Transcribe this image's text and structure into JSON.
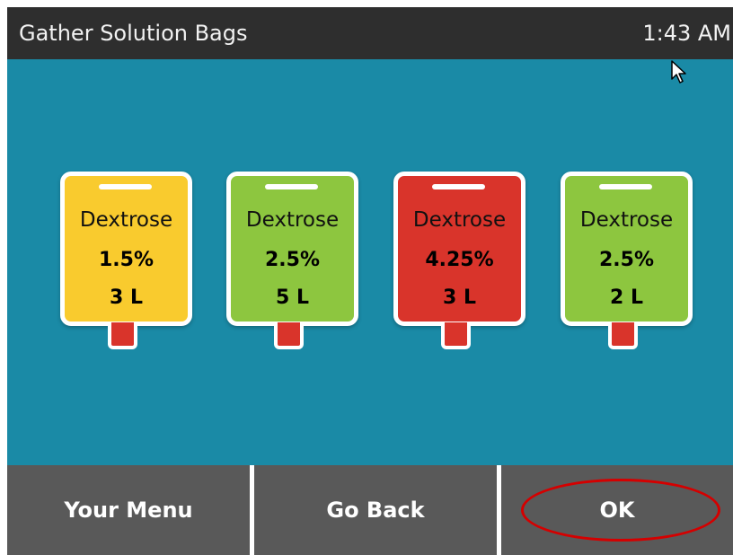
{
  "header": {
    "title": "Gather Solution Bags",
    "time": "1:43 AM"
  },
  "bags": [
    {
      "name": "Dextrose",
      "concentration": "1.5%",
      "volume": "3 L",
      "color": "#f9cb2e"
    },
    {
      "name": "Dextrose",
      "concentration": "2.5%",
      "volume": "5 L",
      "color": "#8dc63f"
    },
    {
      "name": "Dextrose",
      "concentration": "4.25%",
      "volume": "3 L",
      "color": "#d9342b"
    },
    {
      "name": "Dextrose",
      "concentration": "2.5%",
      "volume": "2 L",
      "color": "#8dc63f"
    }
  ],
  "footer": {
    "your_menu_label": "Your Menu",
    "go_back_label": "Go Back",
    "ok_label": "OK"
  },
  "colors": {
    "background": "#1a8aa6",
    "header_bg": "#2e2e2e",
    "footer_bg": "#595959",
    "highlight_ring": "#d40000"
  },
  "icons": {
    "cursor": "arrow-pointer-icon"
  }
}
